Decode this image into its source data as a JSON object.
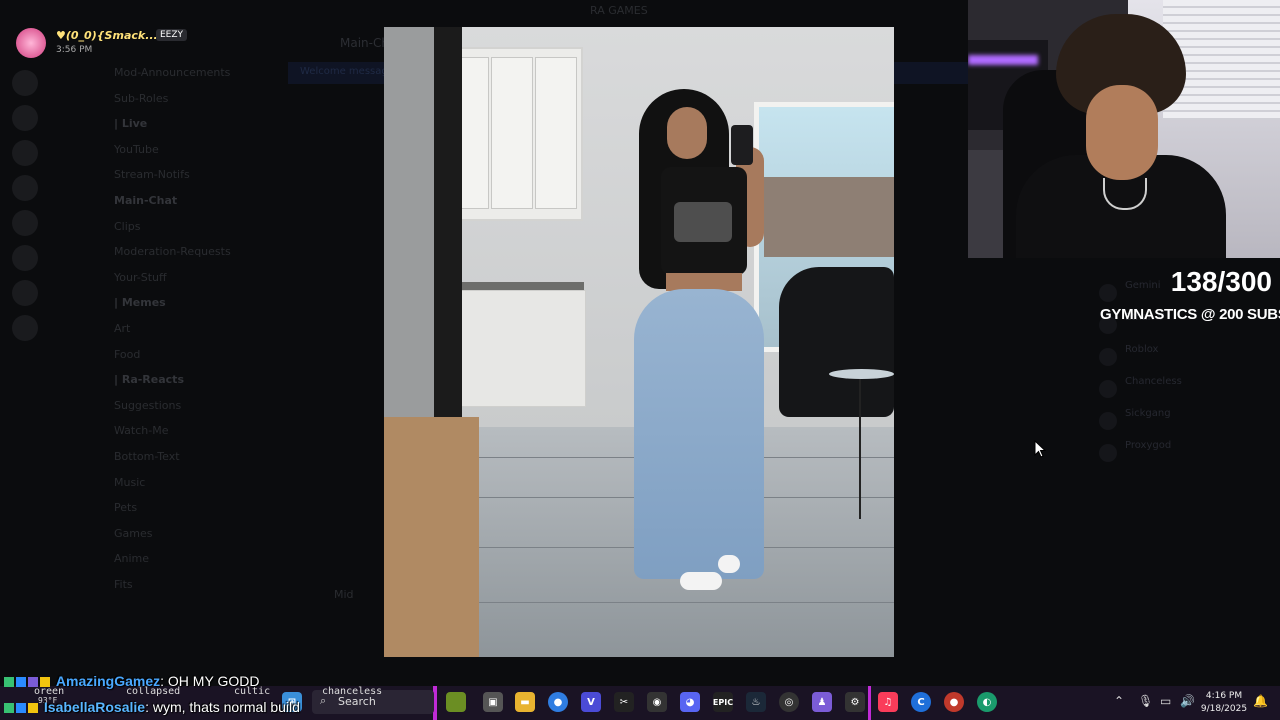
{
  "window": {
    "title": "RA GAMES"
  },
  "discord": {
    "channels": [
      {
        "label": "Mod-Announcements",
        "category": false
      },
      {
        "label": "Sub-Roles",
        "category": false
      },
      {
        "label": "| Live",
        "category": true
      },
      {
        "label": "YouTube",
        "category": false
      },
      {
        "label": "Stream-Notifs",
        "category": false
      },
      {
        "label": "Main-Chat",
        "category": true
      },
      {
        "label": "Clips",
        "category": false
      },
      {
        "label": "Moderation-Requests",
        "category": false
      },
      {
        "label": "Your-Stuff",
        "category": false
      },
      {
        "label": "| Memes",
        "category": true
      },
      {
        "label": "Art",
        "category": false
      },
      {
        "label": "Food",
        "category": false
      },
      {
        "label": "| Ra-Reacts",
        "category": true
      },
      {
        "label": "Suggestions",
        "category": false
      },
      {
        "label": "Watch-Me",
        "category": false
      },
      {
        "label": "Bottom-Text",
        "category": false
      },
      {
        "label": "Music",
        "category": false
      },
      {
        "label": "Pets",
        "category": false
      },
      {
        "label": "Games",
        "category": false
      },
      {
        "label": "Anime",
        "category": false
      },
      {
        "label": "Fits",
        "category": false
      }
    ],
    "chat_title": "Main-Chat",
    "banner_text": "Welcome messages",
    "members": [
      "Gemini",
      "Ethan V",
      "Roblox",
      "Chanceless",
      "Sickgang",
      "Proxygod"
    ],
    "faint_msg": "Mid"
  },
  "notification": {
    "name": "♥(0_0){Smack...",
    "tag": "EEZY",
    "time": "3:56 PM"
  },
  "stream": {
    "sub_count": "138/300",
    "goal_text": "GYMNASTICS @ 200 SUBS"
  },
  "chat_overlay": [
    {
      "user": "AmazingGamez",
      "message": ": OH MY GODD"
    },
    {
      "user": "IsabellaRosalie",
      "message": ": wym, thats normal build"
    }
  ],
  "hidden_chat": {
    "a": "oreen",
    "b": "collapsed",
    "c": "cultic",
    "d": "chanceless",
    "e": "93°F"
  },
  "taskbar": {
    "search_label": "Search",
    "time": "4:16 PM",
    "date": "9/18/2025",
    "epic_label": "EPIC"
  },
  "colors": {
    "taskbar_accent": "#c02bd6",
    "username": "#4aa8ff"
  }
}
